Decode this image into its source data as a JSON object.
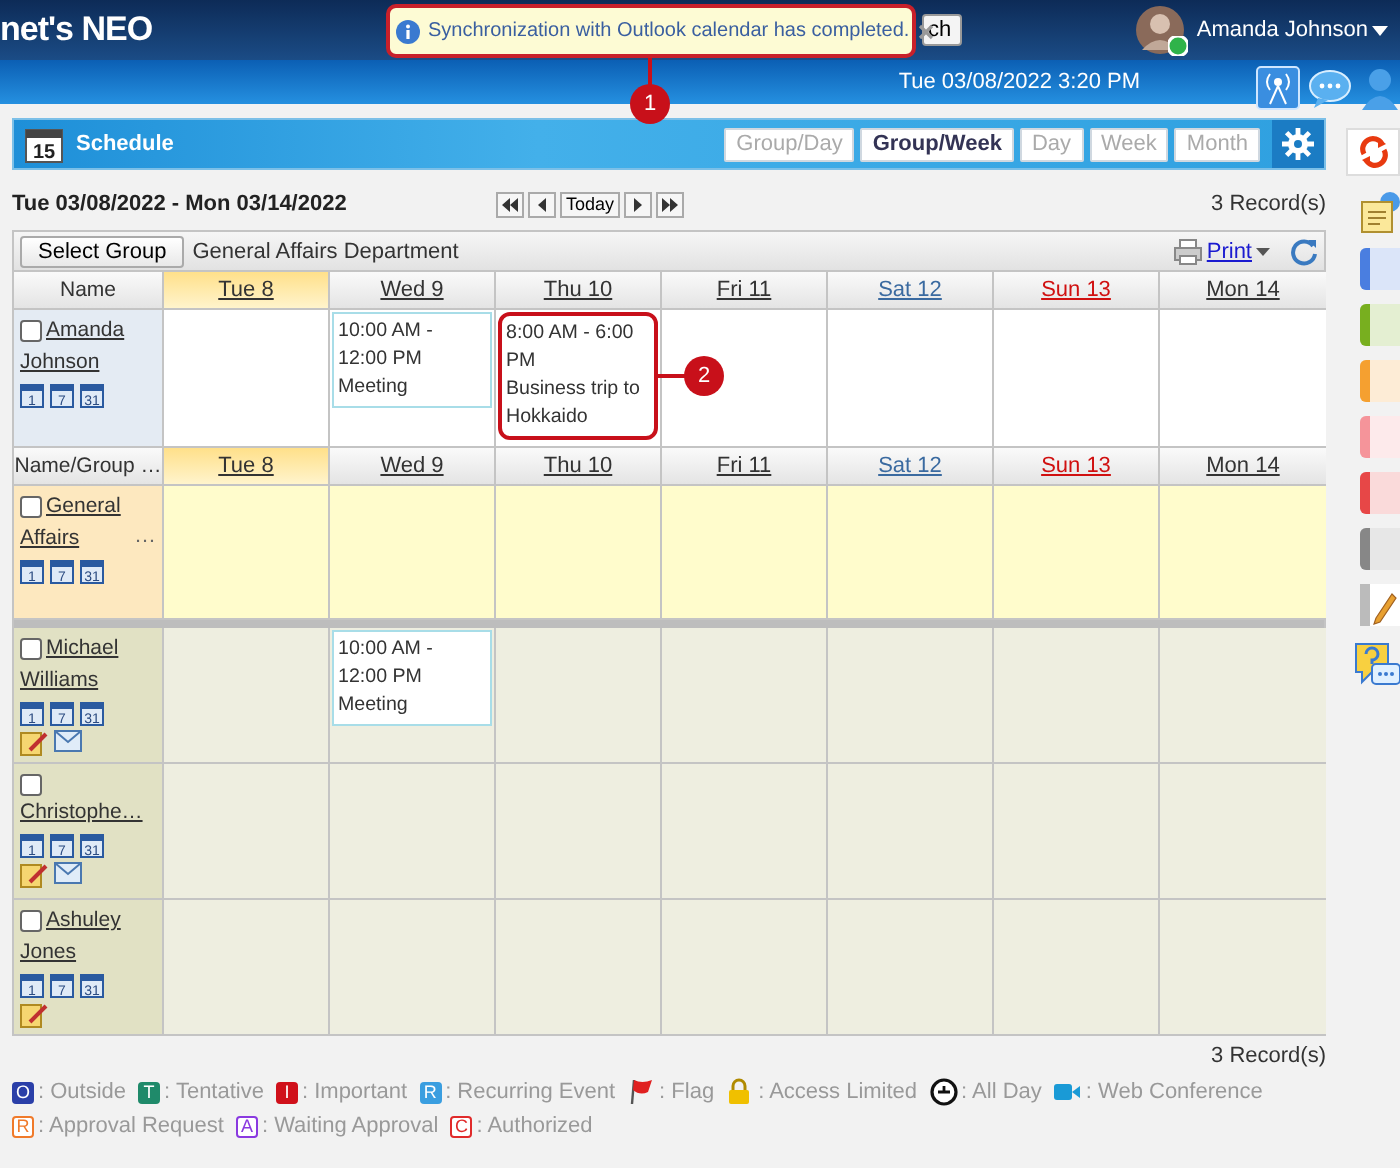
{
  "header": {
    "logo": "net's NEO",
    "search_button": "ch",
    "user": {
      "name": "Amanda Johnson",
      "online": true
    }
  },
  "toast": {
    "message": "Synchronization with Outlook calendar has completed.",
    "callout": "1"
  },
  "datetime": "Tue 03/08/2022 3:20 PM",
  "app": {
    "title": "Schedule",
    "icon_day": "15",
    "views": [
      {
        "label": "Group/Day",
        "selected": false
      },
      {
        "label": "Group/Week",
        "selected": true
      },
      {
        "label": "Day",
        "selected": false
      },
      {
        "label": "Week",
        "selected": false
      },
      {
        "label": "Month",
        "selected": false
      }
    ]
  },
  "range": "Tue 03/08/2022 - Mon 03/14/2022",
  "today_button": "Today",
  "records_top": "3 Record(s)",
  "toolbar": {
    "select_group": "Select Group",
    "group_name": "General Affairs Department",
    "print": "Print"
  },
  "personal": {
    "header": "Name",
    "days": [
      {
        "label": "Tue 8",
        "kind": "today"
      },
      {
        "label": "Wed 9",
        "kind": "weekday"
      },
      {
        "label": "Thu 10",
        "kind": "weekday"
      },
      {
        "label": "Fri 11",
        "kind": "weekday"
      },
      {
        "label": "Sat 12",
        "kind": "saturday"
      },
      {
        "label": "Sun 13",
        "kind": "sunday"
      },
      {
        "label": "Mon 14",
        "kind": "weekday"
      }
    ],
    "member": {
      "name": "Amanda Johnson",
      "checked": false,
      "views": [
        "1",
        "7",
        "31"
      ],
      "cells": [
        null,
        {
          "time": "10:00 AM - 12:00 PM",
          "title": "Meeting"
        },
        {
          "time": "8:00 AM - 6:00 PM",
          "title": "Business trip to Hokkaido",
          "callout": "2"
        },
        null,
        null,
        null,
        null
      ]
    }
  },
  "group": {
    "header": "Name/Group …",
    "days": [
      {
        "label": "Tue 8",
        "kind": "today"
      },
      {
        "label": "Wed 9",
        "kind": "weekday"
      },
      {
        "label": "Thu 10",
        "kind": "weekday"
      },
      {
        "label": "Fri 11",
        "kind": "weekday"
      },
      {
        "label": "Sat 12",
        "kind": "saturday"
      },
      {
        "label": "Sun 13",
        "kind": "sunday"
      },
      {
        "label": "Mon 14",
        "kind": "weekday"
      }
    ],
    "name": "General Affairs",
    "more": "…",
    "checked": false,
    "views": [
      "1",
      "7",
      "31"
    ]
  },
  "members": [
    {
      "name": "Michael Williams",
      "checked": false,
      "views": [
        "1",
        "7",
        "31"
      ],
      "memo": true,
      "mail": true,
      "cells": [
        null,
        {
          "time": "10:00 AM - 12:00 PM",
          "title": "Meeting"
        },
        null,
        null,
        null,
        null,
        null
      ]
    },
    {
      "name": "Christophe…",
      "checked": false,
      "views": [
        "1",
        "7",
        "31"
      ],
      "memo": true,
      "mail": true,
      "cells": [
        null,
        null,
        null,
        null,
        null,
        null,
        null
      ]
    },
    {
      "name": "Ashuley Jones",
      "checked": false,
      "views": [
        "1",
        "7",
        "31"
      ],
      "memo": true,
      "cells": [
        null,
        null,
        null,
        null,
        null,
        null,
        null
      ]
    }
  ],
  "records_bottom": "3 Record(s)",
  "legend": [
    [
      {
        "kind": "filled",
        "mark": "O",
        "color": "#2a3fa8",
        "label": ": Outside"
      },
      {
        "kind": "filled",
        "mark": "T",
        "color": "#1f8a6a",
        "label": ": Tentative"
      },
      {
        "kind": "filled",
        "mark": "I",
        "color": "#d0101a",
        "label": ": Important"
      },
      {
        "kind": "filled",
        "mark": "R",
        "color": "#3a9ee0",
        "label": ": Recurring Event"
      },
      {
        "kind": "flag",
        "label": ": Flag"
      },
      {
        "kind": "lock",
        "label": ": Access Limited"
      },
      {
        "kind": "allday",
        "label": ": All Day"
      },
      {
        "kind": "camera",
        "label": ": Web Conference"
      }
    ],
    [
      {
        "kind": "outline",
        "mark": "R",
        "color": "#f07a2a",
        "label": ": Approval Request"
      },
      {
        "kind": "outline",
        "mark": "A",
        "color": "#8a3ae0",
        "label": ": Waiting Approval"
      },
      {
        "kind": "outline",
        "mark": "C",
        "color": "#e02a2a",
        "label": ": Authorized"
      }
    ]
  ],
  "palette": [
    {
      "color": "#4a7fe0"
    },
    {
      "color": "#78b020"
    },
    {
      "color": "#f5a030"
    },
    {
      "color": "#f5949a"
    },
    {
      "color": "#e84848"
    },
    {
      "color": "#888888"
    }
  ]
}
